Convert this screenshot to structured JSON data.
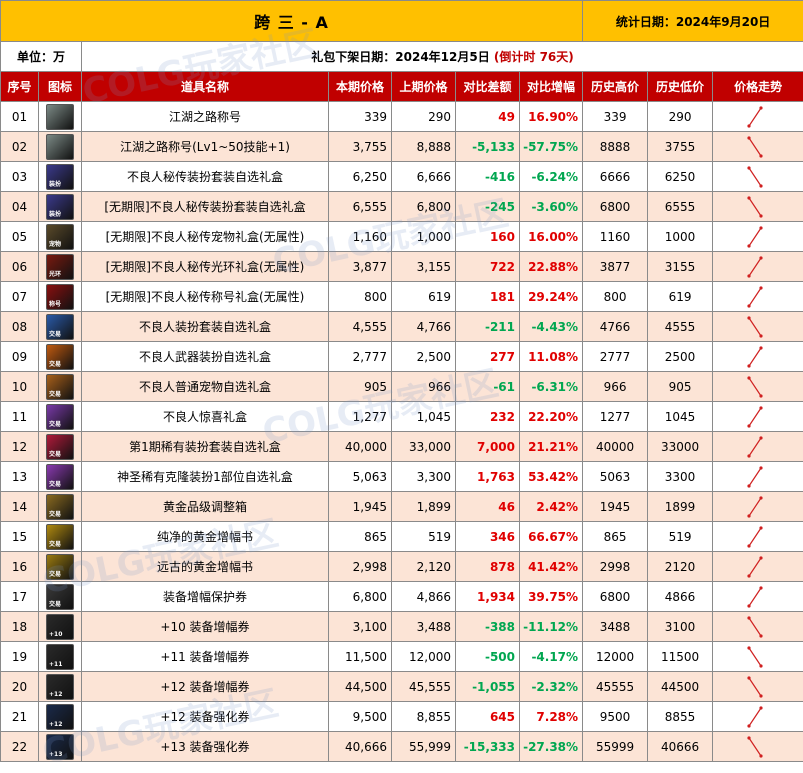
{
  "header": {
    "title": "跨 三 - A",
    "stat_date": "统计日期：2024年9月20日",
    "unit": "单位：万",
    "offshelf_prefix": "礼包下架日期：2024年12月5日",
    "countdown": "(倒计时 76天)"
  },
  "columns": [
    "序号",
    "图标",
    "道具名称",
    "本期价格",
    "上期价格",
    "对比差额",
    "对比增幅",
    "历史高价",
    "历史低价",
    "价格走势"
  ],
  "watermark": "COLG玩家社区",
  "rows": [
    {
      "no": "01",
      "name": "江湖之路称号",
      "cur": "339",
      "prev": "290",
      "diff": "49",
      "pct": "16.90%",
      "high": "339",
      "low": "290",
      "trend": "up",
      "icon": "seal-icon",
      "icon_color": "#7c8a86",
      "tag": ""
    },
    {
      "no": "02",
      "name": "江湖之路称号(Lv1~50技能+1)",
      "cur": "3,755",
      "prev": "8,888",
      "diff": "-5,133",
      "pct": "-57.75%",
      "high": "8888",
      "low": "3755",
      "trend": "down",
      "icon": "seal-icon",
      "icon_color": "#7c8a86",
      "tag": ""
    },
    {
      "no": "03",
      "name": "不良人秘传装扮套装自选礼盒",
      "cur": "6,250",
      "prev": "6,666",
      "diff": "-416",
      "pct": "-6.24%",
      "high": "6666",
      "low": "6250",
      "trend": "down",
      "icon": "costume-box-icon",
      "icon_color": "#3b3a8c",
      "tag": "装扮"
    },
    {
      "no": "04",
      "name": "[无期限]不良人秘传装扮套装自选礼盒",
      "cur": "6,555",
      "prev": "6,800",
      "diff": "-245",
      "pct": "-3.60%",
      "high": "6800",
      "low": "6555",
      "trend": "down",
      "icon": "costume-box-icon",
      "icon_color": "#3b3a8c",
      "tag": "装扮"
    },
    {
      "no": "05",
      "name": "[无期限]不良人秘传宠物礼盒(无属性)",
      "cur": "1,160",
      "prev": "1,000",
      "diff": "160",
      "pct": "16.00%",
      "high": "1160",
      "low": "1000",
      "trend": "up",
      "icon": "pet-box-icon",
      "icon_color": "#5a4a2a",
      "tag": "宠物"
    },
    {
      "no": "06",
      "name": "[无期限]不良人秘传光环礼盒(无属性)",
      "cur": "3,877",
      "prev": "3,155",
      "diff": "722",
      "pct": "22.88%",
      "high": "3877",
      "low": "3155",
      "trend": "up",
      "icon": "aura-box-icon",
      "icon_color": "#7a1a10",
      "tag": "光环"
    },
    {
      "no": "07",
      "name": "[无期限]不良人秘传称号礼盒(无属性)",
      "cur": "800",
      "prev": "619",
      "diff": "181",
      "pct": "29.24%",
      "high": "800",
      "low": "619",
      "trend": "up",
      "icon": "title-box-icon",
      "icon_color": "#8a1010",
      "tag": "称号"
    },
    {
      "no": "08",
      "name": "不良人装扮套装自选礼盒",
      "cur": "4,555",
      "prev": "4,766",
      "diff": "-211",
      "pct": "-4.43%",
      "high": "4766",
      "low": "4555",
      "trend": "down",
      "icon": "costume-box-icon",
      "icon_color": "#2a5aa8",
      "tag": "交易"
    },
    {
      "no": "09",
      "name": "不良人武器装扮自选礼盒",
      "cur": "2,777",
      "prev": "2,500",
      "diff": "277",
      "pct": "11.08%",
      "high": "2777",
      "low": "2500",
      "trend": "up",
      "icon": "weapon-box-icon",
      "icon_color": "#c05a10",
      "tag": "交易"
    },
    {
      "no": "10",
      "name": "不良人普通宠物自选礼盒",
      "cur": "905",
      "prev": "966",
      "diff": "-61",
      "pct": "-6.31%",
      "high": "966",
      "low": "905",
      "trend": "down",
      "icon": "pet-box-icon",
      "icon_color": "#a8601a",
      "tag": "交易"
    },
    {
      "no": "11",
      "name": "不良人惊喜礼盒",
      "cur": "1,277",
      "prev": "1,045",
      "diff": "232",
      "pct": "22.20%",
      "high": "1277",
      "low": "1045",
      "trend": "up",
      "icon": "gift-box-icon",
      "icon_color": "#7a3aa8",
      "tag": "交易"
    },
    {
      "no": "12",
      "name": "第1期稀有装扮套装自选礼盒",
      "cur": "40,000",
      "prev": "33,000",
      "diff": "7,000",
      "pct": "21.21%",
      "high": "40000",
      "low": "33000",
      "trend": "up",
      "icon": "rare-box-icon",
      "icon_color": "#b01a3a",
      "tag": "交易"
    },
    {
      "no": "13",
      "name": "神圣稀有克隆装扮1部位自选礼盒",
      "cur": "5,063",
      "prev": "3,300",
      "diff": "1,763",
      "pct": "53.42%",
      "high": "5063",
      "low": "3300",
      "trend": "up",
      "icon": "clone-box-icon",
      "icon_color": "#8a3ab0",
      "tag": "交易"
    },
    {
      "no": "14",
      "name": "黄金品级调整箱",
      "cur": "1,945",
      "prev": "1,899",
      "diff": "46",
      "pct": "2.42%",
      "high": "1945",
      "low": "1899",
      "trend": "up",
      "icon": "golden-chest-icon",
      "icon_color": "#8a6a20",
      "tag": "交易"
    },
    {
      "no": "15",
      "name": "纯净的黄金增幅书",
      "cur": "865",
      "prev": "519",
      "diff": "346",
      "pct": "66.67%",
      "high": "865",
      "low": "519",
      "trend": "up",
      "icon": "golden-book-icon",
      "icon_color": "#b08a10",
      "tag": "交易"
    },
    {
      "no": "16",
      "name": "远古的黄金增幅书",
      "cur": "2,998",
      "prev": "2,120",
      "diff": "878",
      "pct": "41.42%",
      "high": "2998",
      "low": "2120",
      "trend": "up",
      "icon": "golden-book-icon",
      "icon_color": "#9a7a10",
      "tag": "交易"
    },
    {
      "no": "17",
      "name": "装备增幅保护券",
      "cur": "6,800",
      "prev": "4,866",
      "diff": "1,934",
      "pct": "39.75%",
      "high": "6800",
      "low": "4866",
      "trend": "up",
      "icon": "protect-ticket-icon",
      "icon_color": "#3a3a3a",
      "tag": "交易"
    },
    {
      "no": "18",
      "name": "+10 装备增幅券",
      "cur": "3,100",
      "prev": "3,488",
      "diff": "-388",
      "pct": "-11.12%",
      "high": "3488",
      "low": "3100",
      "trend": "down",
      "icon": "amplify-ticket-icon",
      "icon_color": "#2a2a2a",
      "tag": "+10"
    },
    {
      "no": "19",
      "name": "+11 装备增幅券",
      "cur": "11,500",
      "prev": "12,000",
      "diff": "-500",
      "pct": "-4.17%",
      "high": "12000",
      "low": "11500",
      "trend": "down",
      "icon": "amplify-ticket-icon",
      "icon_color": "#2a2a2a",
      "tag": "+11"
    },
    {
      "no": "20",
      "name": "+12 装备增幅券",
      "cur": "44,500",
      "prev": "45,555",
      "diff": "-1,055",
      "pct": "-2.32%",
      "high": "45555",
      "low": "44500",
      "trend": "down",
      "icon": "amplify-ticket-icon",
      "icon_color": "#2a2a2a",
      "tag": "+12"
    },
    {
      "no": "21",
      "name": "+12 装备强化券",
      "cur": "9,500",
      "prev": "8,855",
      "diff": "645",
      "pct": "7.28%",
      "high": "9500",
      "low": "8855",
      "trend": "up",
      "icon": "reinforce-ticket-icon",
      "icon_color": "#1a2a4a",
      "tag": "+12"
    },
    {
      "no": "22",
      "name": "+13 装备强化券",
      "cur": "40,666",
      "prev": "55,999",
      "diff": "-15,333",
      "pct": "-27.38%",
      "high": "55999",
      "low": "40666",
      "trend": "down",
      "icon": "reinforce-ticket-icon",
      "icon_color": "#1a2a4a",
      "tag": "+13"
    }
  ]
}
